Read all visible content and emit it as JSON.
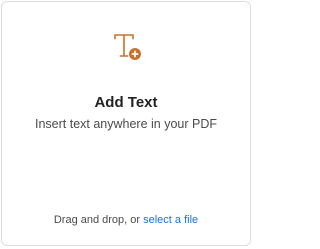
{
  "tool_card": {
    "icon": "add-text-icon",
    "accent_color": "#c8732c",
    "title": "Add Text",
    "description": "Insert text anywhere in your PDF",
    "drop_prompt": "Drag and drop, or",
    "select_file_link": "select a file",
    "link_color": "#1473e6"
  }
}
